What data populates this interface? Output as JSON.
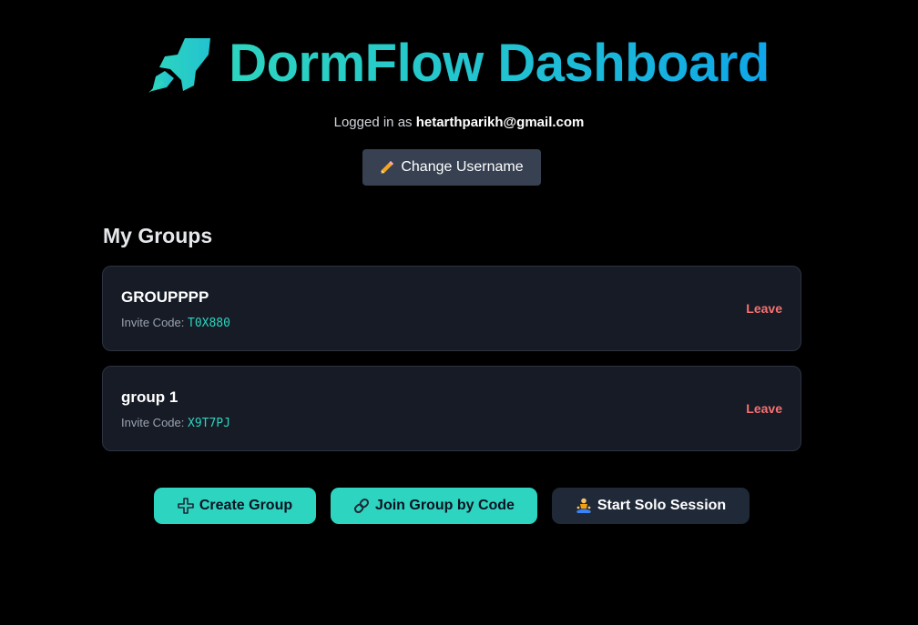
{
  "app": {
    "title": "DormFlow Dashboard",
    "icon": "rocket-icon"
  },
  "session": {
    "logged_in_prefix": "Logged in as",
    "email": "hetarthparikh@gmail.com"
  },
  "change_username": {
    "label": "Change Username",
    "icon": "pencil-icon"
  },
  "groups_section": {
    "title": "My Groups",
    "invite_label": "Invite Code:",
    "leave_label": "Leave",
    "groups": [
      {
        "name": "GROUPPPP",
        "invite_code": "T0X880"
      },
      {
        "name": "group 1",
        "invite_code": "X9T7PJ"
      }
    ]
  },
  "actions": {
    "create_group": {
      "label": "Create Group",
      "icon": "plus-icon"
    },
    "join_group": {
      "label": "Join Group by Code",
      "icon": "link-icon"
    },
    "solo_session": {
      "label": "Start Solo Session",
      "icon": "meditation-icon"
    }
  },
  "colors": {
    "accent": "#2dd4bf",
    "accent_blue": "#0ea5e9",
    "danger": "#f87171",
    "card_bg": "#161b26",
    "background": "#000000"
  }
}
